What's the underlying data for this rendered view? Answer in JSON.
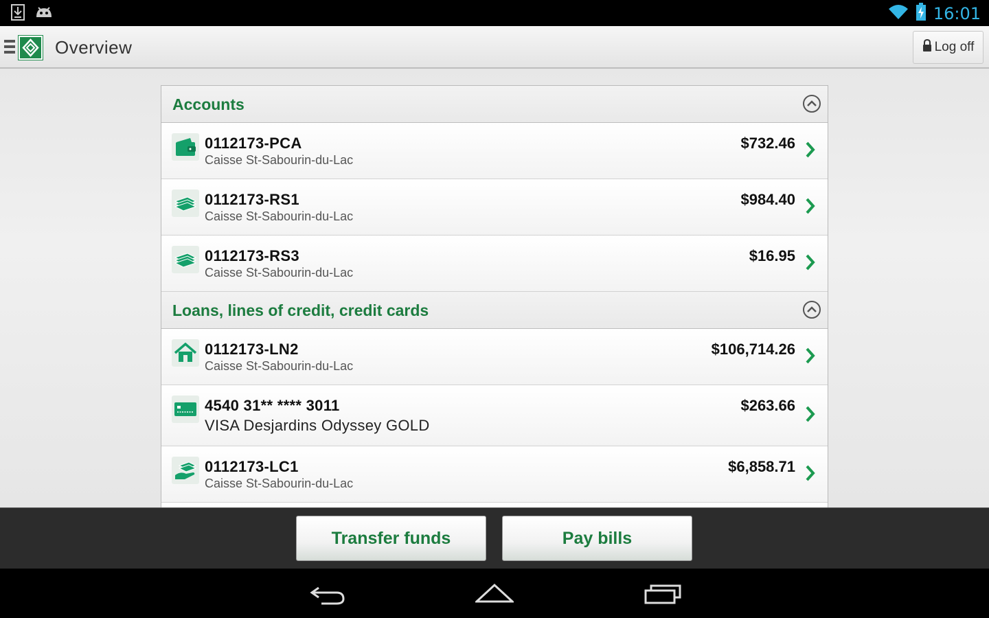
{
  "status_bar": {
    "time": "16:01"
  },
  "header": {
    "title": "Overview",
    "logoff_label": "Log off"
  },
  "sections": [
    {
      "title": "Accounts",
      "rows": [
        {
          "account": "0112173-PCA",
          "institution": "Caisse St-Sabourin-du-Lac",
          "amount": "$732.46",
          "icon": "wallet-icon"
        },
        {
          "account": "0112173-RS1",
          "institution": "Caisse St-Sabourin-du-Lac",
          "amount": "$984.40",
          "icon": "cash-stack-icon"
        },
        {
          "account": "0112173-RS3",
          "institution": "Caisse St-Sabourin-du-Lac",
          "amount": "$16.95",
          "icon": "cash-stack-icon"
        }
      ]
    },
    {
      "title": "Loans, lines of credit, credit cards",
      "rows": [
        {
          "account": "0112173-LN2",
          "institution": "Caisse St-Sabourin-du-Lac",
          "amount": "$106,714.26",
          "icon": "house-icon"
        },
        {
          "account": "4540 31** **** 3011",
          "institution": "VISA Desjardins Odyssey GOLD",
          "amount": "$263.66",
          "icon": "credit-card-icon"
        },
        {
          "account": "0112173-LC1",
          "institution": "Caisse St-Sabourin-du-Lac",
          "amount": "$6,858.71",
          "icon": "hand-cash-icon"
        }
      ]
    }
  ],
  "actions": {
    "transfer_label": "Transfer funds",
    "pay_label": "Pay bills"
  },
  "colors": {
    "brand_green": "#1c7c3f",
    "status_blue": "#33b5e5"
  }
}
